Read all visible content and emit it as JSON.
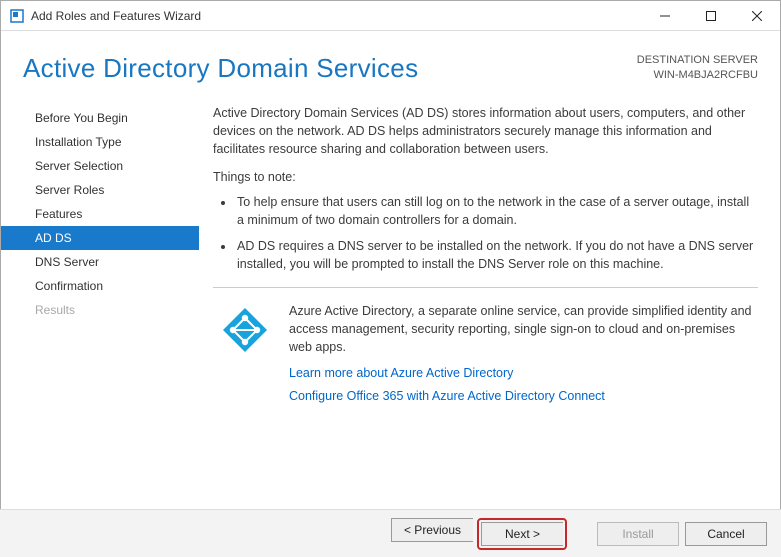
{
  "window": {
    "title": "Add Roles and Features Wizard"
  },
  "header": {
    "title": "Active Directory Domain Services",
    "destination_label": "DESTINATION SERVER",
    "destination_value": "WIN-M4BJA2RCFBU"
  },
  "sidebar": {
    "items": [
      {
        "label": "Before You Begin",
        "state": "normal"
      },
      {
        "label": "Installation Type",
        "state": "normal"
      },
      {
        "label": "Server Selection",
        "state": "normal"
      },
      {
        "label": "Server Roles",
        "state": "normal"
      },
      {
        "label": "Features",
        "state": "normal"
      },
      {
        "label": "AD DS",
        "state": "active"
      },
      {
        "label": "DNS Server",
        "state": "normal"
      },
      {
        "label": "Confirmation",
        "state": "normal"
      },
      {
        "label": "Results",
        "state": "disabled"
      }
    ]
  },
  "content": {
    "intro": "Active Directory Domain Services (AD DS) stores information about users, computers, and other devices on the network.  AD DS helps administrators securely manage this information and facilitates resource sharing and collaboration between users.",
    "notes_title": "Things to note:",
    "notes": [
      "To help ensure that users can still log on to the network in the case of a server outage, install a minimum of two domain controllers for a domain.",
      "AD DS requires a DNS server to be installed on the network.  If you do not have a DNS server installed, you will be prompted to install the DNS Server role on this machine."
    ],
    "azure": {
      "desc": "Azure Active Directory, a separate online service, can provide simplified identity and access management, security reporting, single sign-on to cloud and on-premises web apps.",
      "link1": "Learn more about Azure Active Directory",
      "link2": "Configure Office 365 with Azure Active Directory Connect"
    }
  },
  "footer": {
    "previous": "< Previous",
    "next": "Next >",
    "install": "Install",
    "cancel": "Cancel"
  }
}
